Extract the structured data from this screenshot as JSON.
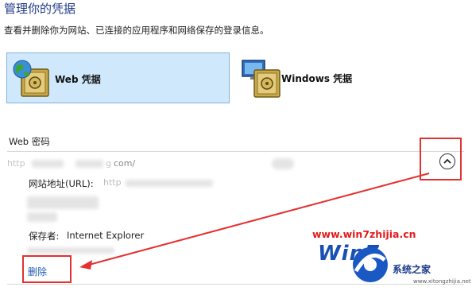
{
  "header": {
    "title": "管理你的凭据",
    "subtitle": "查看并删除你为网站、已连接的应用程序和网络保存的登录信息。"
  },
  "tiles": [
    {
      "label": "Web 凭据",
      "icon": "web-credentials-vault-icon",
      "selected": true
    },
    {
      "label": "Windows 凭据",
      "icon": "windows-credentials-vault-icon",
      "selected": false
    }
  ],
  "section": {
    "title": "Web 密码"
  },
  "credential": {
    "url_fragment_1": "http",
    "url_fragment_2": "g",
    "url_fragment_3": "com/",
    "url_label": "网站地址(URL):",
    "url_value_prefix": "http",
    "saved_by_label": "保存者:",
    "saved_by_value": "Internet Explorer",
    "delete_label": "删除"
  },
  "watermark": {
    "url": "www.win7zhijia.cn",
    "logo_text": "Win7",
    "brand": "系统之家",
    "site": "www.xitongzhijia.net"
  },
  "colors": {
    "accent": "#1e3a8a",
    "tile_selected_bg": "#cfe8fb",
    "annotation": "#e53030",
    "link": "#1c5cb8"
  }
}
